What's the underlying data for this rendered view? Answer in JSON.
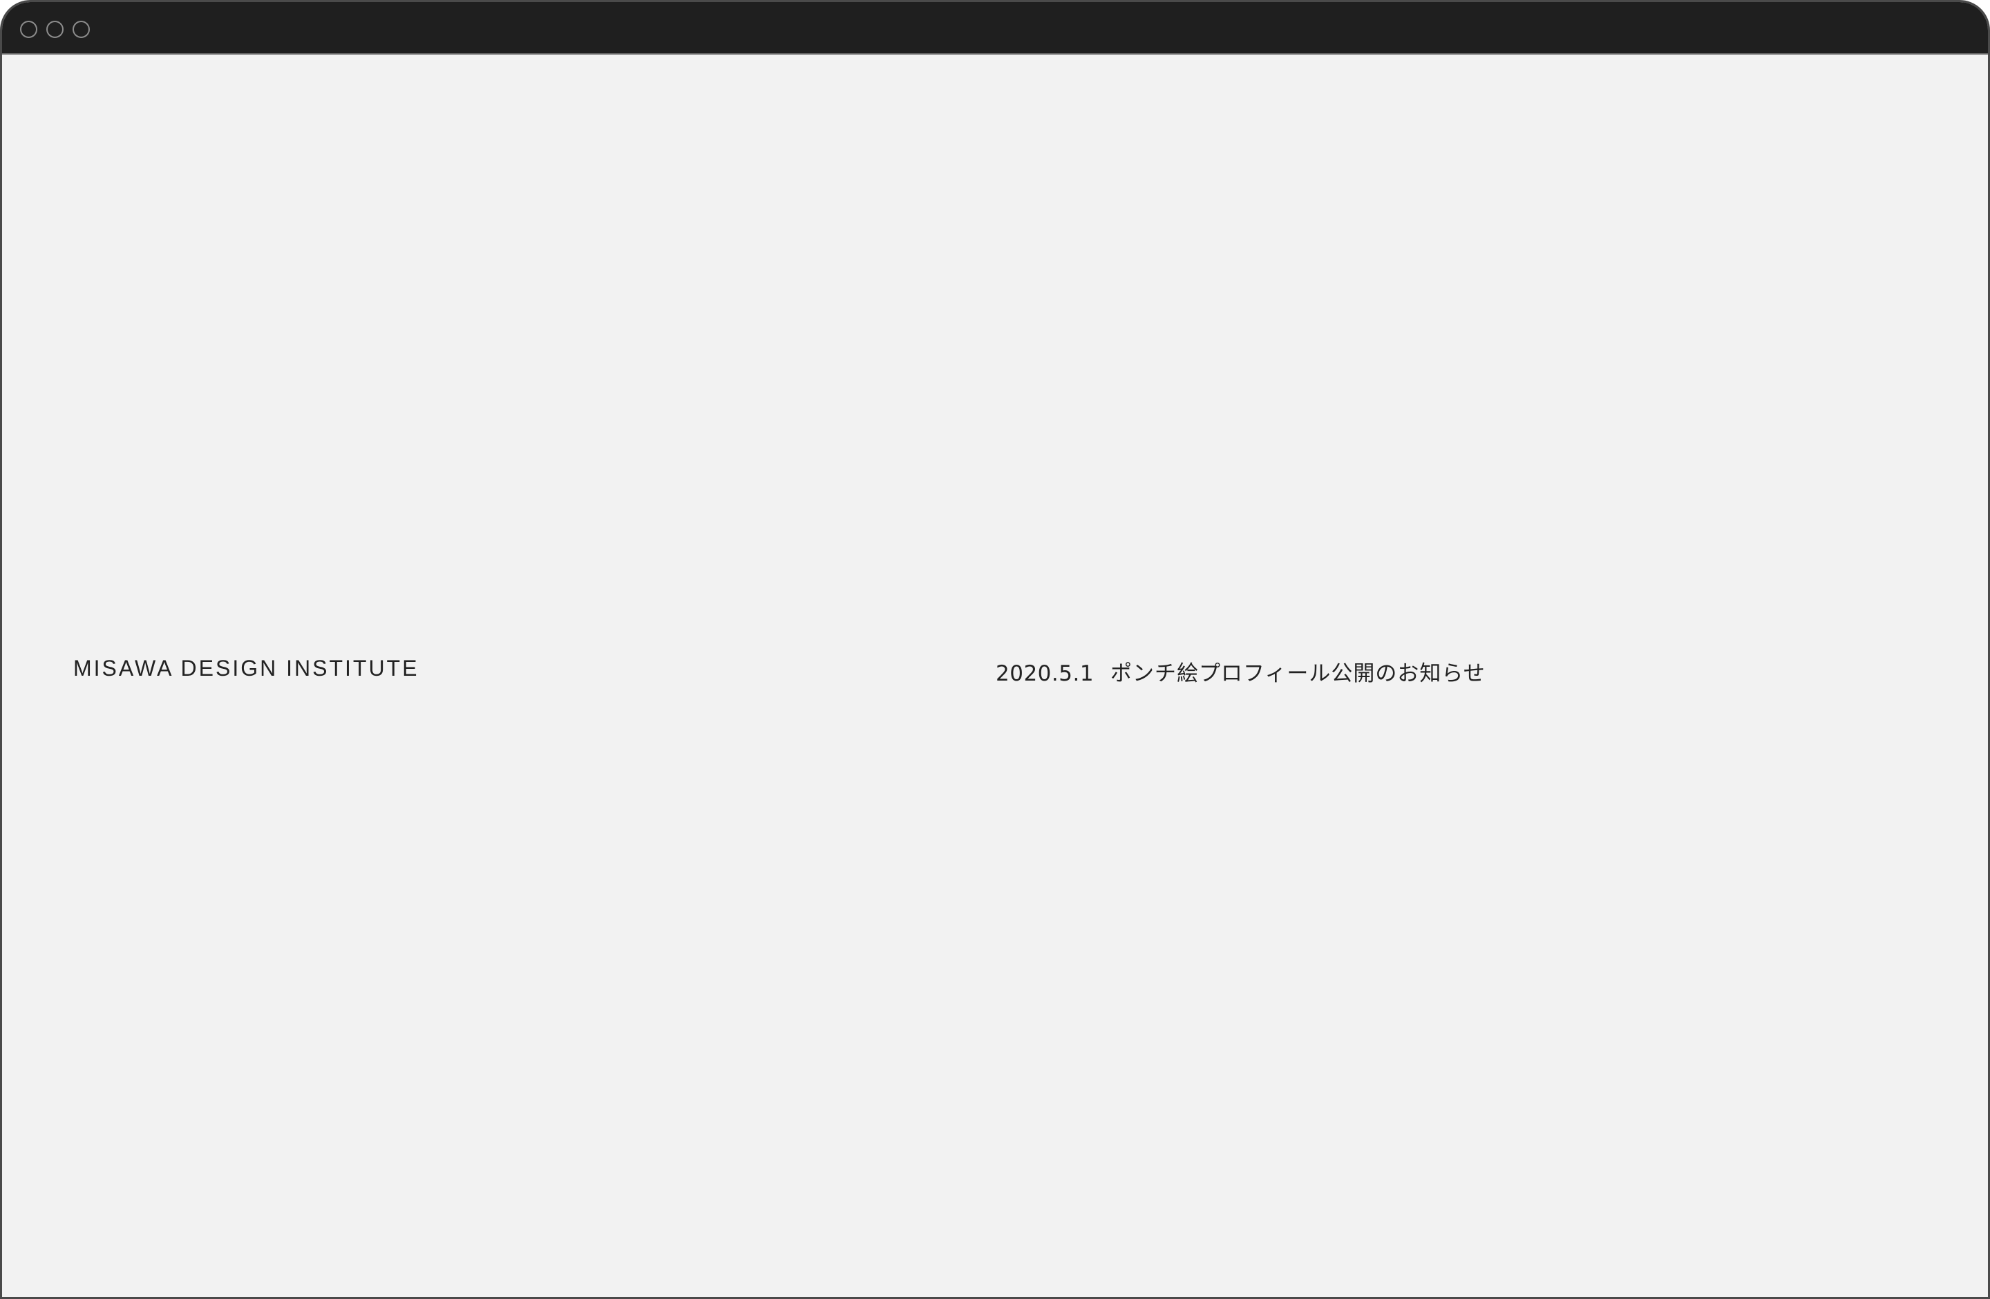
{
  "site": {
    "brand": "MISAWA DESIGN INSTITUTE"
  },
  "news": {
    "date": "2020.5.1",
    "title": "ポンチ絵プロフィール公開のお知らせ"
  },
  "colors": {
    "titlebar": "#1f1f1f",
    "page_background": "#f2f2f2",
    "text": "#222222",
    "window_border": "#4a4a4a"
  }
}
